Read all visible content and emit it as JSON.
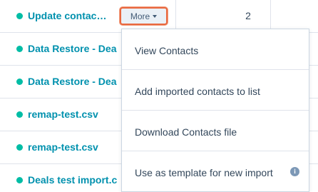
{
  "imports": [
    {
      "name": "Update contac…",
      "count": "2"
    },
    {
      "name": "Data Restore - Dea"
    },
    {
      "name": "Data Restore - Dea"
    },
    {
      "name": "remap-test.csv"
    },
    {
      "name": "remap-test.csv"
    },
    {
      "name": "Deals test import.c"
    }
  ],
  "more_button": {
    "label": "More",
    "icon": "caret-down-icon"
  },
  "menu": {
    "items": [
      {
        "label": "View Contacts"
      },
      {
        "label": "Add imported contacts to list"
      },
      {
        "label": "Download Contacts file"
      },
      {
        "label": "Use as template for new import",
        "info_icon": "info-icon",
        "info_glyph": "i"
      }
    ]
  },
  "colors": {
    "status_dot": "#00bda5",
    "link": "#0091ae",
    "highlight_border": "#e8683f",
    "button_bg": "#eaf0f6"
  }
}
